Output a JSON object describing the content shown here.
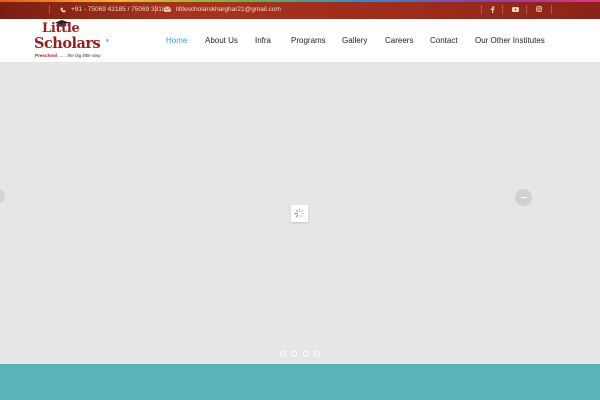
{
  "topbar": {
    "phone": "+91 - 75069 42185 / 75069 33185",
    "email": "littlescholarskharghar21@gmail.com",
    "phone_icon": "phone-icon",
    "email_icon": "envelope-icon",
    "social": [
      "facebook-icon",
      "youtube-icon",
      "instagram-icon"
    ]
  },
  "logo": {
    "line1": "Little",
    "line2": "Scholars",
    "registered": "®",
    "tag_bold": "Preschool",
    "tag_rest": " ...... the big little step"
  },
  "nav": {
    "items": [
      "Home",
      "About Us",
      "Infra",
      "Programs",
      "Gallery",
      "Careers",
      "Contact",
      "Our Other Institutes"
    ],
    "active": "Home"
  },
  "slider": {
    "prev_icon": "arrow-left-icon",
    "next_icon": "arrow-right-icon",
    "loader_icon": "spinner-icon",
    "dot_count": 4
  },
  "colors": {
    "brand_red": "#9b1c1c",
    "topbar": "#9c2c1b",
    "nav_active": "#2aa7c9",
    "teal_band": "#5ab3b7",
    "slider_bg": "#e6e6e6"
  }
}
